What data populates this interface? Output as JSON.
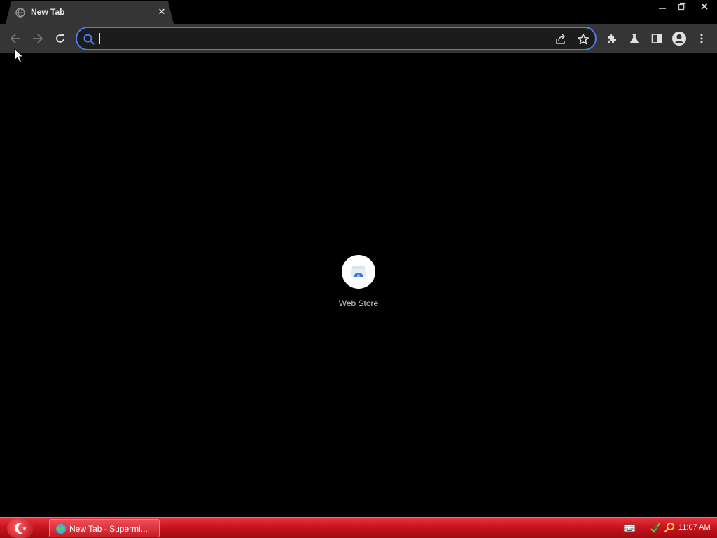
{
  "tab": {
    "title": "New Tab",
    "close_glyph": "✕"
  },
  "window_controls": [
    "minimize-icon",
    "restore-icon",
    "close-icon"
  ],
  "toolbar": {
    "back_icon": "arrow-left-icon",
    "forward_icon": "arrow-right-icon",
    "reload_icon": "reload-icon",
    "omnibox": {
      "value": "",
      "placeholder": ""
    },
    "icons": [
      "share-icon",
      "star-icon",
      "extensions-icon",
      "labs-flask-icon",
      "side-panel-icon",
      "profile-icon",
      "menu-icon"
    ]
  },
  "shortcuts": [
    {
      "label": "Web Store",
      "icon": "web-store-icon"
    }
  ],
  "taskbar": {
    "task_label": "New Tab - Supermi...",
    "clock": "11:07 AM",
    "colors": {
      "accent": "#c8141d"
    }
  },
  "colors": {
    "omnibox_focus": "#4a7fe8",
    "toolbar": "#353535",
    "background": "#000000"
  }
}
